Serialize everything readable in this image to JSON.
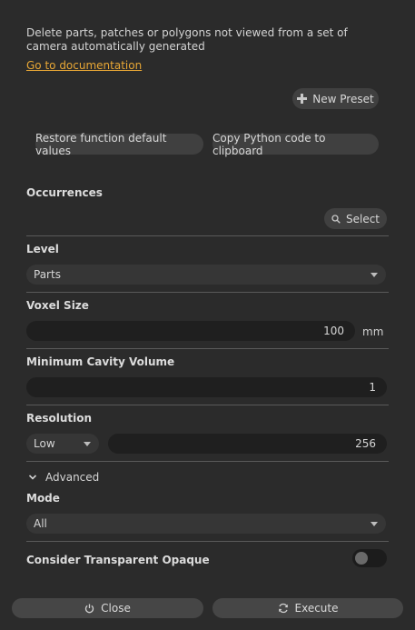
{
  "description": "Delete parts, patches or polygons not viewed from a set of camera automatically generated",
  "doc_link": "Go to documentation",
  "new_preset": "New Preset",
  "restore_defaults": "Restore function default values",
  "copy_python": "Copy Python code to clipboard",
  "occurrences": {
    "label": "Occurrences",
    "select_button": "Select"
  },
  "level": {
    "label": "Level",
    "value": "Parts"
  },
  "voxel_size": {
    "label": "Voxel Size",
    "value": "100",
    "unit": "mm"
  },
  "min_cavity_volume": {
    "label": "Minimum Cavity Volume",
    "value": "1"
  },
  "resolution": {
    "label": "Resolution",
    "preset": "Low",
    "value": "256"
  },
  "advanced": {
    "label": "Advanced",
    "mode_label": "Mode",
    "mode_value": "All"
  },
  "consider_transparent": {
    "label": "Consider Transparent Opaque",
    "enabled": false
  },
  "footer": {
    "close": "Close",
    "execute": "Execute"
  },
  "colors": {
    "background": "#2b2b2b",
    "link": "#e8a735",
    "button": "#404040",
    "field": "#1f1f1f"
  }
}
